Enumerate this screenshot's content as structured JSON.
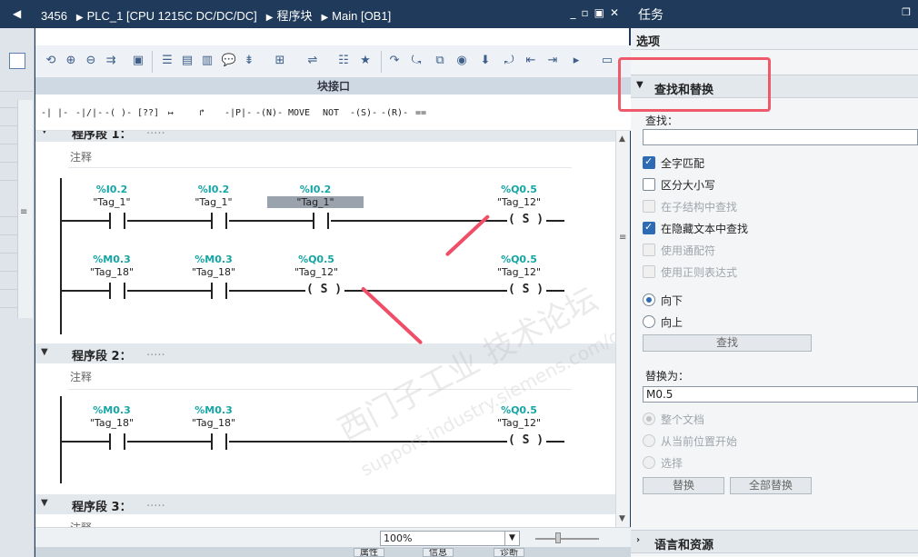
{
  "editor": {
    "breadcrumb": [
      "3456",
      "PLC_1 [CPU 1215C DC/DC/DC]",
      "程序块",
      "Main [OB1]"
    ],
    "block_interface_label": "块接口",
    "ladder_elements": [
      "-| |-",
      "-|/|-",
      "-( )-",
      "[??]",
      "↦",
      "↱",
      "-|P|-",
      "-(N)-",
      "MOVE",
      "NOT",
      "-(S)-",
      "-(R)-",
      "=="
    ],
    "zoom": "100%",
    "bottom_tabs": [
      "属性",
      "信息",
      "诊断"
    ]
  },
  "networks": [
    {
      "header": "程序段 1：",
      "comment": "注释",
      "rungs": [
        {
          "contacts": [
            {
              "address": "%I0.2",
              "tag": "\"Tag_1\""
            },
            {
              "address": "%I0.2",
              "tag": "\"Tag_1\""
            },
            {
              "address": "%I0.2",
              "tag": "\"Tag_1\"",
              "highlighted": true
            }
          ],
          "coil": {
            "address": "%Q0.5",
            "tag": "\"Tag_12\"",
            "symbol": "( S )"
          }
        },
        {
          "contacts": [
            {
              "address": "%M0.3",
              "tag": "\"Tag_18\""
            },
            {
              "address": "%M0.3",
              "tag": "\"Tag_18\""
            }
          ],
          "mid_coil": {
            "address": "%Q0.5",
            "tag": "\"Tag_12\"",
            "symbol": "( S )"
          },
          "coil": {
            "address": "%Q0.5",
            "tag": "\"Tag_12\"",
            "symbol": "( S )"
          }
        }
      ]
    },
    {
      "header": "程序段 2：",
      "comment": "注释",
      "rungs": [
        {
          "contacts": [
            {
              "address": "%M0.3",
              "tag": "\"Tag_18\""
            },
            {
              "address": "%M0.3",
              "tag": "\"Tag_18\""
            }
          ],
          "coil": {
            "address": "%Q0.5",
            "tag": "\"Tag_12\"",
            "symbol": "( S )"
          }
        }
      ]
    },
    {
      "header": "程序段 3：",
      "comment": "注释"
    }
  ],
  "task_panel": {
    "title": "任务",
    "options_label": "选项",
    "find_replace": {
      "section_label": "查找和替换",
      "find_label": "查找：",
      "find_value": "",
      "checkboxes": [
        {
          "label": "全字匹配",
          "checked": true,
          "enabled": true
        },
        {
          "label": "区分大小写",
          "checked": false,
          "enabled": true
        },
        {
          "label": "在子结构中查找",
          "checked": false,
          "enabled": false
        },
        {
          "label": "在隐藏文本中查找",
          "checked": true,
          "enabled": true
        },
        {
          "label": "使用通配符",
          "checked": false,
          "enabled": false
        },
        {
          "label": "使用正则表达式",
          "checked": false,
          "enabled": false
        }
      ],
      "direction": [
        {
          "label": "向下",
          "selected": true
        },
        {
          "label": "向上",
          "selected": false
        }
      ],
      "find_button": "查找",
      "replace_label": "替换为：",
      "replace_value": "M0.5",
      "scope": [
        {
          "label": "整个文档",
          "selected": true
        },
        {
          "label": "从当前位置开始",
          "selected": false
        },
        {
          "label": "选择",
          "selected": false
        }
      ],
      "replace_button": "替换",
      "replace_all_button": "全部替换"
    },
    "language_section_label": "语言和资源"
  },
  "watermark": {
    "line1": "西门子工业 技术论坛",
    "line2": "support.industry.siemens.com/cs"
  },
  "colors": {
    "title_bar": "#1f3a5a",
    "address_teal": "#16a5a5",
    "annotation_red": "#ee5a6a",
    "checkbox_blue": "#2d6cb5"
  }
}
